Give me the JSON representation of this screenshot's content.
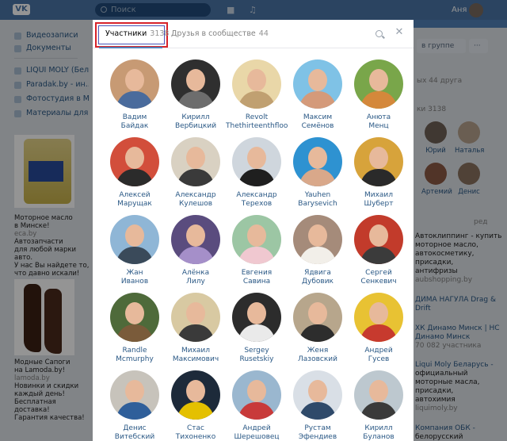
{
  "topbar": {
    "logo": "VK",
    "search_placeholder": "Поиск",
    "user_name": "Аня"
  },
  "left_nav": [
    {
      "label": "Видеозаписи",
      "icon": "video-icon"
    },
    {
      "label": "Документы",
      "icon": "document-icon"
    },
    {
      "label": "LIQUI MOLY (Бел...",
      "icon": "group-icon"
    },
    {
      "label": "Paradak.by - ин...",
      "icon": "group-icon"
    },
    {
      "label": "Фотостудия в Ми...",
      "icon": "group-icon"
    },
    {
      "label": "Материалы для к...",
      "icon": "group-icon"
    }
  ],
  "ads": [
    {
      "lines": [
        "Моторное масло",
        "в Минске!"
      ],
      "source": "eca.by",
      "desc": [
        "Автозапчасти",
        "для любой марки авто.",
        "У нас Вы найдете то,",
        "что давно искали!"
      ]
    },
    {
      "lines": [
        "Модные Сапоги",
        "на Lamoda.by!"
      ],
      "source": "lamoda.by",
      "desc": [
        "Новинки и скидки",
        "каждый день!",
        "Бесплатная доставка!",
        "Гарантия качества!"
      ]
    }
  ],
  "right": {
    "join_button": "в группе",
    "friends_count": "ых 44 друга",
    "members_label": "ки 3138",
    "friend_names": [
      "Юрий",
      "Наталья",
      "Артемий",
      "Денис"
    ],
    "ad_label": "ред",
    "ad_lines": [
      "Автоклиппинг - купить",
      "моторное масло,",
      "автокосметику,",
      "присадки,",
      "антифризы"
    ],
    "ad_source": "aubshopping.by",
    "events": [
      {
        "title": "ДИМА НАГУЛА Drag &",
        "sub": "Drift"
      },
      {
        "title": "ХК Динамо Минск | НС",
        "sub": "Динамо Минск"
      },
      {
        "title": "70 082 участника",
        "sub": ""
      },
      {
        "title": "Liqui Moly Беларусь -",
        "sub": "официальный"
      },
      {
        "title": "моторные масла,",
        "sub": "присадки,"
      },
      {
        "title": "автохимия",
        "sub": "liquimoly.by"
      },
      {
        "title": "Компания ОБК -",
        "sub": "белорусский"
      }
    ]
  },
  "modal": {
    "tab_members": {
      "label": "Участники",
      "count": "3138"
    },
    "tab_friends": {
      "label": "Друзья в сообществе",
      "count": "44"
    },
    "members": [
      {
        "first": "Вадим",
        "last": "Байдак",
        "bg": "#c79a74",
        "shirt": "#4a6b9c"
      },
      {
        "first": "Кирилл",
        "last": "Вербицкий",
        "bg": "#2f2f2f",
        "shirt": "#6d6d6d"
      },
      {
        "first": "Revolt",
        "last": "Thethirteenthfloor",
        "bg": "#e9d7a8",
        "shirt": "#c0a071"
      },
      {
        "first": "Максим",
        "last": "Семёнов",
        "bg": "#7fc2e6",
        "shirt": "#d49a7a"
      },
      {
        "first": "Анюта",
        "last": "Менц",
        "bg": "#79a64a",
        "shirt": "#d4883b"
      },
      {
        "first": "Алексей",
        "last": "Марущак",
        "bg": "#d24e3b",
        "shirt": "#2b2b2b"
      },
      {
        "first": "Александр",
        "last": "Кулешов",
        "bg": "#d9d1c2",
        "shirt": "#3a3a3a"
      },
      {
        "first": "Александр",
        "last": "Терехов",
        "bg": "#cfd6dd",
        "shirt": "#1f1f1f"
      },
      {
        "first": "Yauhen",
        "last": "Barysevich",
        "bg": "#2e92d1",
        "shirt": "#d9a88a"
      },
      {
        "first": "Михаил",
        "last": "Шуберт",
        "bg": "#d7a33b",
        "shirt": "#2a2a2a"
      },
      {
        "first": "Жан",
        "last": "Иванов",
        "bg": "#8fb6d6",
        "shirt": "#3a4a5a"
      },
      {
        "first": "Алёнка",
        "last": "Лилу",
        "bg": "#5a4c7e",
        "shirt": "#a58fc9"
      },
      {
        "first": "Евгения",
        "last": "Савина",
        "bg": "#9cc6a4",
        "shirt": "#f0c8d0"
      },
      {
        "first": "Ядвига",
        "last": "Дубовик",
        "bg": "#a58b7a",
        "shirt": "#f2efe9"
      },
      {
        "first": "Сергей",
        "last": "Сенкевич",
        "bg": "#c23b2b",
        "shirt": "#3b3b3b"
      },
      {
        "first": "Randle",
        "last": "Mcmurphy",
        "bg": "#4e6a3a",
        "shirt": "#7a5b3a"
      },
      {
        "first": "Михаил",
        "last": "Максимович",
        "bg": "#d8c9a2",
        "shirt": "#3a3a3a"
      },
      {
        "first": "Sergey",
        "last": "Rusetskiy",
        "bg": "#2c2c2c",
        "shirt": "#eaeaea"
      },
      {
        "first": "Женя",
        "last": "Лазовский",
        "bg": "#b7a68c",
        "shirt": "#2d2d2d"
      },
      {
        "first": "Андрей",
        "last": "Гусев",
        "bg": "#e8c233",
        "shirt": "#c73a2e"
      },
      {
        "first": "Денис",
        "last": "Витебский",
        "bg": "#c7c3bb",
        "shirt": "#2f5f9a"
      },
      {
        "first": "Стас",
        "last": "Тихоненко",
        "bg": "#1d2a3a",
        "shirt": "#e4c000"
      },
      {
        "first": "Андрей",
        "last": "Шерешовец",
        "bg": "#9ab7cf",
        "shirt": "#c83a3a"
      },
      {
        "first": "Рустам",
        "last": "Эфендиев",
        "bg": "#d9dfe6",
        "shirt": "#2f4a6a"
      },
      {
        "first": "Кирилл",
        "last": "Буланов",
        "bg": "#bdc8cf",
        "shirt": "#3a3a3a"
      }
    ]
  }
}
